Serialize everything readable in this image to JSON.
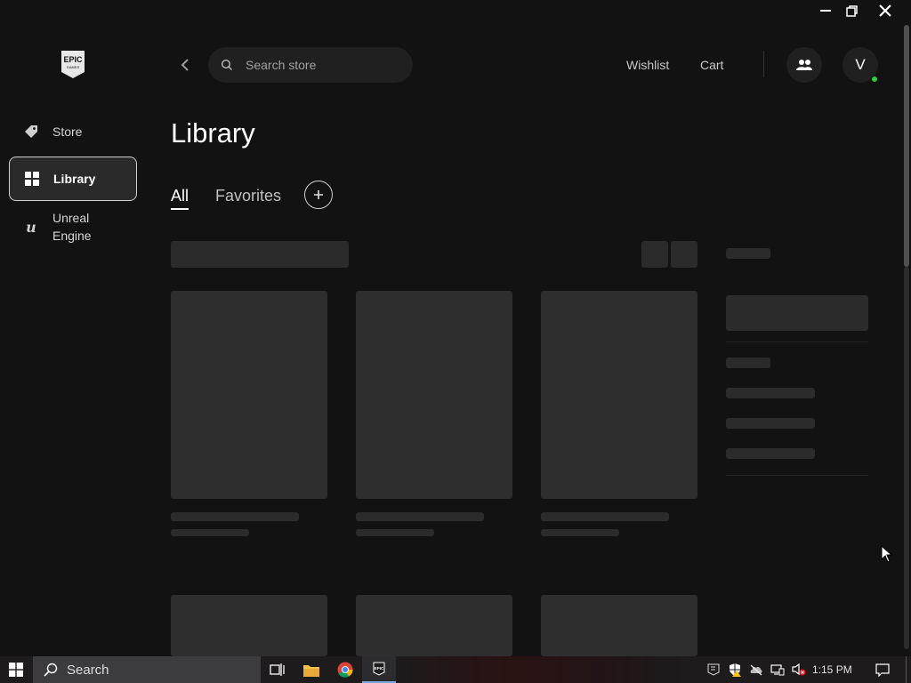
{
  "window": {
    "minimize_icon": "minimize-icon",
    "maximize_icon": "restore-icon",
    "close_icon": "close-icon"
  },
  "sidebar": {
    "logo_text_top": "EPIC",
    "logo_text_bottom": "GAMES",
    "items": [
      {
        "label": "Store",
        "icon": "tag-icon",
        "active": false
      },
      {
        "label": "Library",
        "icon": "grid-icon",
        "active": true
      },
      {
        "label": "Unreal Engine",
        "icon": "unreal-icon",
        "active": false
      }
    ]
  },
  "header": {
    "search_placeholder": "Search store",
    "wishlist_label": "Wishlist",
    "cart_label": "Cart",
    "avatar_initial": "V",
    "online_color": "#2ecc40"
  },
  "main": {
    "title": "Library",
    "tabs": [
      {
        "label": "All",
        "active": true
      },
      {
        "label": "Favorites",
        "active": false
      }
    ],
    "add_tab_icon": "plus-icon",
    "loading_placeholder_color": "#2e2e2e"
  },
  "taskbar": {
    "search_label": "Search",
    "clock": "1:15 PM",
    "epic_icon_text": "EPIC"
  }
}
